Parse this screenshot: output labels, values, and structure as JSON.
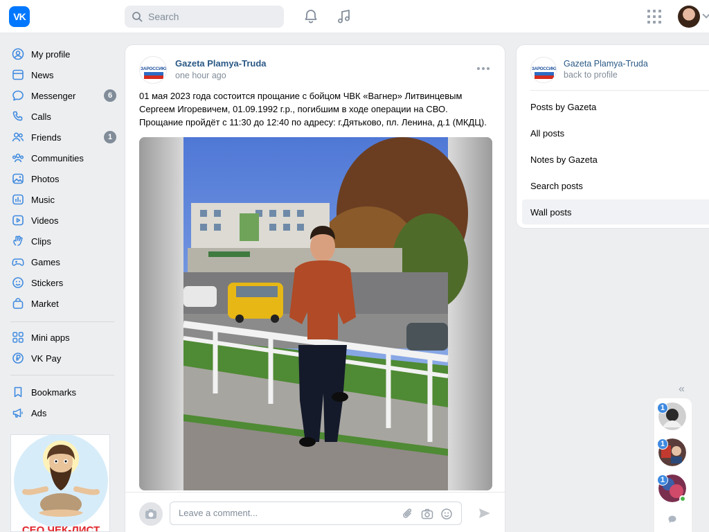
{
  "header": {
    "logo_text": "VK",
    "search_placeholder": "Search"
  },
  "sidebar": {
    "items": [
      {
        "label": "My profile",
        "icon": "user-circle-icon"
      },
      {
        "label": "News",
        "icon": "newspaper-icon"
      },
      {
        "label": "Messenger",
        "icon": "chat-bubble-icon",
        "badge": "6"
      },
      {
        "label": "Calls",
        "icon": "phone-icon"
      },
      {
        "label": "Friends",
        "icon": "people-icon",
        "badge": "1"
      },
      {
        "label": "Communities",
        "icon": "group-icon"
      },
      {
        "label": "Photos",
        "icon": "image-icon"
      },
      {
        "label": "Music",
        "icon": "equalizer-icon"
      },
      {
        "label": "Videos",
        "icon": "play-video-icon"
      },
      {
        "label": "Clips",
        "icon": "clips-hand-icon"
      },
      {
        "label": "Games",
        "icon": "gamepad-icon"
      },
      {
        "label": "Stickers",
        "icon": "smile-icon"
      },
      {
        "label": "Market",
        "icon": "shopping-bag-icon"
      },
      {
        "label": "Mini apps",
        "icon": "grid-apps-icon"
      },
      {
        "label": "VK Pay",
        "icon": "ruble-coin-icon"
      },
      {
        "label": "Bookmarks",
        "icon": "bookmark-icon"
      },
      {
        "label": "Ads",
        "icon": "megaphone-icon"
      }
    ],
    "ad_banner_text": "СЕО ЧЕК-ЛИСТ"
  },
  "post": {
    "author": "Gazeta Plamya-Truda",
    "time": "one hour ago",
    "avatar_text": "ЗАРОССИЮ",
    "text_lines": [
      "01 мая 2023 года состоится прощание с бойцом ЧВК «Вагнер» Литвинцевым",
      "Сергеем Игоревичем, 01.09.1992 г.р., погибшим в ходе операции на СВО.",
      "Прощание пройдёт с 11:30 до 12:40 по адресу: г.Дятьково, пл. Ленина, д.1 (МКДЦ)."
    ],
    "comment_placeholder": "Leave a comment..."
  },
  "right_panel": {
    "name": "Gazeta Plamya-Truda",
    "back": "back to profile",
    "avatar_text": "ЗАРОССИЮ",
    "items": [
      "Posts by Gazeta",
      "All posts",
      "Notes by Gazeta",
      "Search posts",
      "Wall posts"
    ],
    "active_item": "Wall posts"
  },
  "chat_rail": {
    "badges": [
      "1",
      "1",
      "1"
    ]
  }
}
